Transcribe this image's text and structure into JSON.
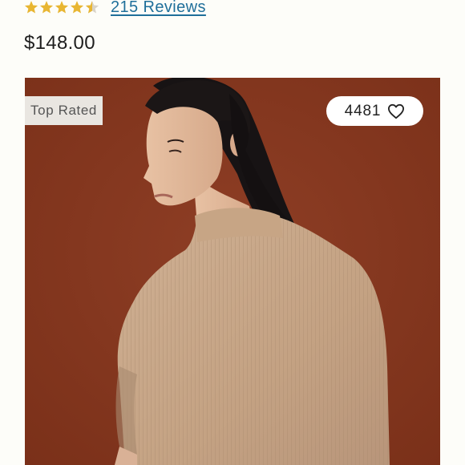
{
  "product": {
    "rating": 4.5,
    "rating_max": 5,
    "reviews_label": "215 Reviews",
    "price": "$148.00",
    "badge": "Top Rated",
    "favorites_count": "4481"
  },
  "colors": {
    "star_fill": "#e8b632",
    "star_empty": "#d9d3c7",
    "link": "#1f6f9a",
    "image_background": "#8a3a22",
    "sweater": "#c9a98a"
  },
  "icons": {
    "rating": "star-icon",
    "favorite": "heart-outline-icon"
  }
}
